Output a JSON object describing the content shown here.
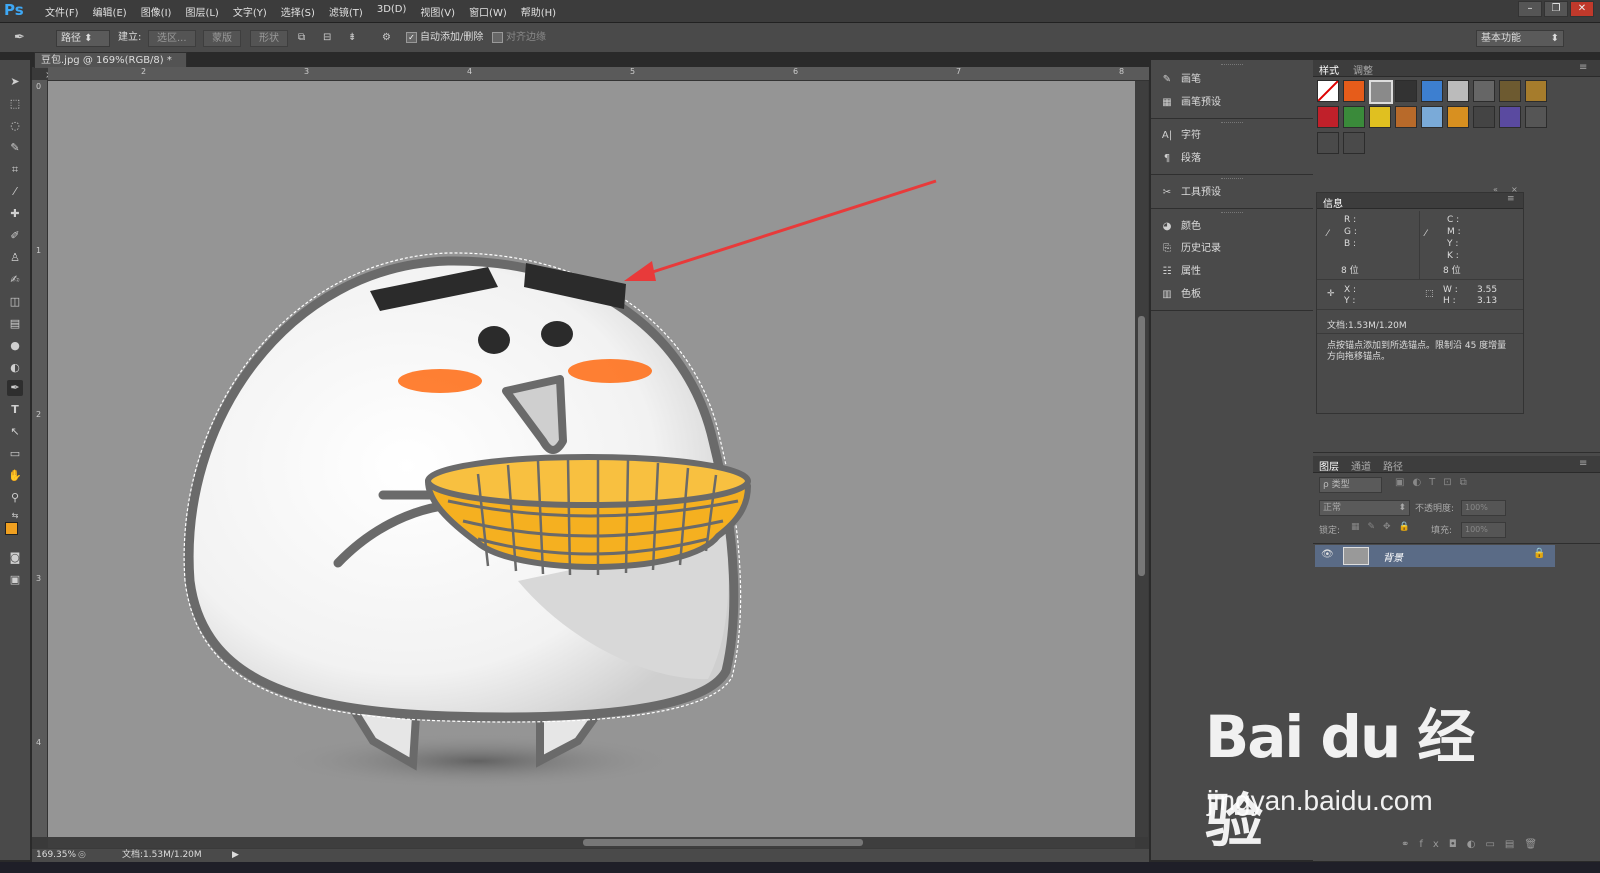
{
  "app": {
    "logo": "Ps"
  },
  "menu": [
    "文件(F)",
    "编辑(E)",
    "图像(I)",
    "图层(L)",
    "文字(Y)",
    "选择(S)",
    "滤镜(T)",
    "3D(D)",
    "视图(V)",
    "窗口(W)",
    "帮助(H)"
  ],
  "window_buttons": [
    "–",
    "❐",
    "✕"
  ],
  "options": {
    "mode": "路径",
    "create_label": "建立:",
    "selection_btn": "选区...",
    "mask_btn": "蒙版",
    "shape_btn": "形状",
    "auto_add_delete": "自动添加/删除",
    "align_edges": "对齐边缘",
    "workspace": "基本功能"
  },
  "document": {
    "tab_title": "豆包.jpg @ 169%(RGB/8) *",
    "ruler_top": [
      "2",
      "3",
      "4",
      "5",
      "6",
      "7",
      "8"
    ],
    "ruler_left": [
      "0",
      "1",
      "2",
      "3",
      "4"
    ],
    "zoom": "169.35%",
    "doc_size": "文档:1.53M/1.20M"
  },
  "dock": {
    "items": [
      {
        "icon": "brush-icon",
        "label": "画笔"
      },
      {
        "icon": "brush-preset-icon",
        "label": "画笔预设"
      },
      {
        "icon": "character-icon",
        "label": "字符"
      },
      {
        "icon": "paragraph-icon",
        "label": "段落"
      },
      {
        "icon": "tool-preset-icon",
        "label": "工具预设"
      },
      {
        "icon": "color-icon",
        "label": "颜色"
      },
      {
        "icon": "history-icon",
        "label": "历史记录"
      },
      {
        "icon": "properties-icon",
        "label": "属性"
      },
      {
        "icon": "swatches-icon",
        "label": "色板"
      }
    ]
  },
  "styles_panel": {
    "tabs": [
      "样式",
      "调整"
    ]
  },
  "info_panel": {
    "tab": "信息",
    "rgb": [
      "R :",
      "G :",
      "B :"
    ],
    "cmyk": [
      "C :",
      "M :",
      "Y :",
      "K :"
    ],
    "bit_left": "8 位",
    "bit_right": "8 位",
    "xy": [
      "X :",
      "Y :"
    ],
    "w_label": "W :",
    "h_label": "H :",
    "w_value": "3.55",
    "h_value": "3.13",
    "doc": "文档:1.53M/1.20M",
    "hint": "点按锚点添加到所选锚点。限制沿 45 度增量方向拖移锚点。"
  },
  "layers_panel": {
    "tabs": [
      "图层",
      "通道",
      "路径"
    ],
    "filter": "ρ 类型",
    "blend": "正常",
    "opacity_label": "不透明度:",
    "opacity_value": "100%",
    "lock_label": "锁定:",
    "fill_label": "填充:",
    "fill_value": "100%",
    "layer_name": "背景"
  },
  "watermark": {
    "main": "Bai du 经验",
    "sub": "jingyan.baidu.com"
  },
  "colors": {
    "accent": "#3ea8f5",
    "foreground": "#f0a020",
    "arrow": "#e83a3a",
    "canvas": "#959595"
  }
}
